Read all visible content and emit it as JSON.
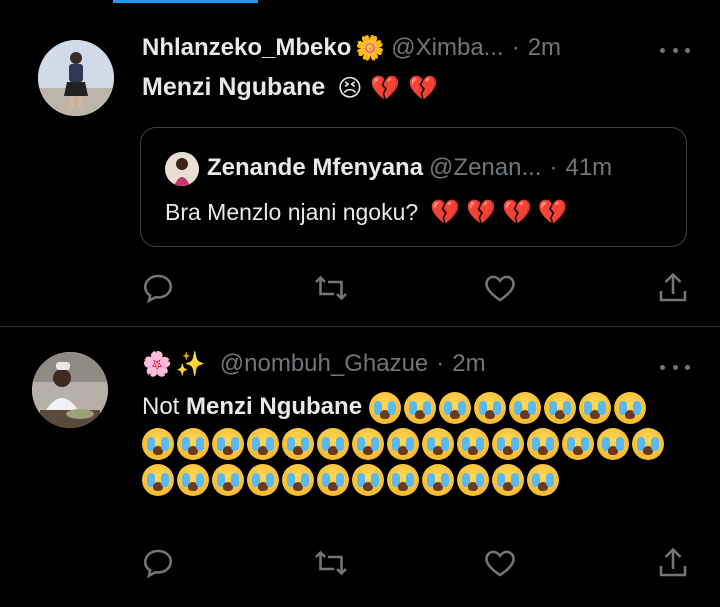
{
  "tweets": [
    {
      "name": "Nhlanzeko_Mbeko",
      "name_emoji": "🌼",
      "handle": "@Ximba...",
      "time": "2m",
      "text": "Menzi Ngubane",
      "text_emojis": [
        "😣",
        "💔",
        "💔"
      ],
      "quote": {
        "name": "Zenande Mfenyana",
        "handle": "@Zenan...",
        "time": "41m",
        "text": "Bra Menzlo njani ngoku?",
        "text_emojis": [
          "💔",
          "💔",
          "💔",
          "💔"
        ]
      }
    },
    {
      "name_emojis": [
        "🌸",
        "✨"
      ],
      "handle": "@nombuh_Ghazue",
      "time": "2m",
      "text_prefix": "Not",
      "text_bold": "Menzi Ngubane",
      "crying_emoji_count": 35
    }
  ],
  "separator": "·",
  "icons": [
    "reply-icon",
    "retweet-icon",
    "like-icon",
    "share-icon",
    "more-icon"
  ],
  "colors": {
    "background": "#000000",
    "text": "#e7e9ea",
    "muted": "#71767b",
    "accent": "#1d9bf0",
    "heart": "#e0245e"
  }
}
